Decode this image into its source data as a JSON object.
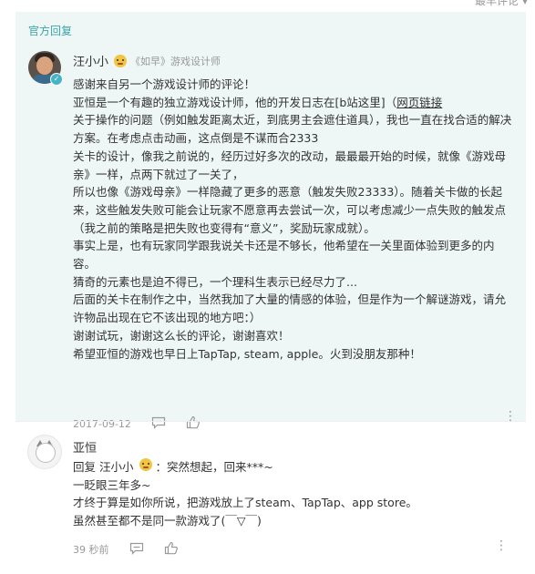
{
  "header": {
    "sort_label": "最早评论"
  },
  "official_reply": {
    "label": "官方回复",
    "username": "汪小小",
    "user_title": "《如早》游戏设计师",
    "paragraphs": [
      "感谢来自另一个游戏设计师的评论！",
      "亚恒是一个有趣的独立游戏设计师，他的开发日志在[b站这里]",
      "关于操作的问题（例如触发距离太近，到底男主会遮住道具），我也一直在找合适的解决方案。在考虑点击动画，这点倒是不谋而合2333",
      "关卡的设计，像我之前说的，经历过好多次的改动，最最最开始的时候，就像《游戏母亲》一样，点两下就过了一关了，",
      "所以也像《游戏母亲》一样隐藏了更多的恶意（触发失败23333）。随着关卡做的长起来，这些触发失败可能会让玩家不愿意再去尝试一次，可以考虑减少一点失败的触发点（我之前的策略是把失败也变得有“意义”，奖励玩家成就）。",
      "事实上是，也有玩家同学跟我说关卡还是不够长，他希望在一关里面体验到更多的内容。",
      "猜奇的元素也是迫不得已，一个理科生表示已经尽力了...",
      "后面的关卡在制作之中，当然我加了大量的情感的体验，但是作为一个解谜游戏，请允许物品出现在它不该出现的地方吧：）",
      "谢谢试玩，谢谢这么长的评论，谢谢喜欢！",
      "希望亚恒的游戏也早日上TapTap, steam, apple。火到没朋友那种！"
    ],
    "link_text": "网页链接",
    "date": "2017-09-12"
  },
  "reply": {
    "username": "亚恒",
    "reply_prefix": "回复",
    "reply_to": "汪小小",
    "lines": [
      "：突然想起，回来***~",
      "一眨眼三年多~",
      "才终于算是如你所说，把游戏放上了steam、TapTap、app store。",
      "虽然甚至都不是同一款游戏了(￣▽￣)"
    ],
    "time": "39 秒前"
  },
  "icons": [
    "comment-icon",
    "thumbs-up-icon",
    "more-vertical-icon",
    "verified-badge-icon",
    "emoji-icon"
  ],
  "colors": {
    "official_bg": "#eef6f6",
    "official_label": "#3aa5a8",
    "meta": "#999999"
  }
}
